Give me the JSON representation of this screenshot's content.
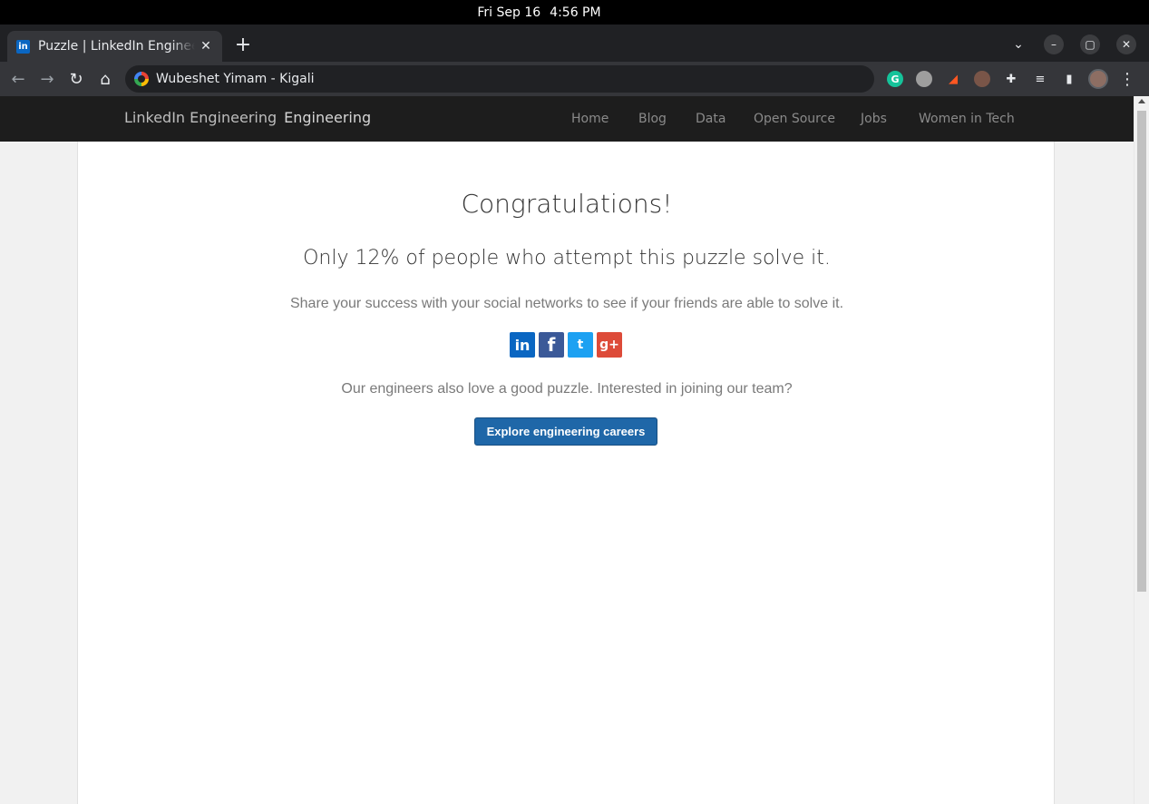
{
  "os": {
    "day": "Fri Sep 16",
    "time": "4:56 PM"
  },
  "browser": {
    "tab_title": "Puzzle | LinkedIn Engineering",
    "favicon_text": "in",
    "tab_close": "✕",
    "new_tab": "+",
    "address": "Wubeshet Yimam - Kigali",
    "icons": [
      "back-icon",
      "forward-icon",
      "reload-icon",
      "home-icon",
      "google-icon",
      "grammarly-icon",
      "extension-icon",
      "puzzle-icon",
      "playlist-icon",
      "side-panel-icon",
      "profile-avatar",
      "menu-icon"
    ]
  },
  "site": {
    "brand_alt": "LinkedIn Engineering",
    "brand_text": "Engineering",
    "nav": [
      "Home",
      "Blog",
      "Data",
      "Open Source",
      "Jobs",
      "Women in Tech"
    ]
  },
  "main": {
    "title": "Congratulations!",
    "stat": "Only 12% of people who attempt this puzzle solve it.",
    "share_text": "Share your success with your social networks to see if your friends are able to solve it.",
    "social": {
      "linkedin": "in",
      "facebook": "f",
      "twitter": "t",
      "google": "g+"
    },
    "careers_text": "Our engineers also love a good puzzle. Interested in joining our team?",
    "cta_label": "Explore engineering careers"
  },
  "colors": {
    "nav_bg": "#1d1d1d",
    "cta": "#1f67a8",
    "linkedin": "#0a66c2",
    "facebook": "#3b5998",
    "twitter": "#1da1f2",
    "google": "#dd4b39"
  }
}
